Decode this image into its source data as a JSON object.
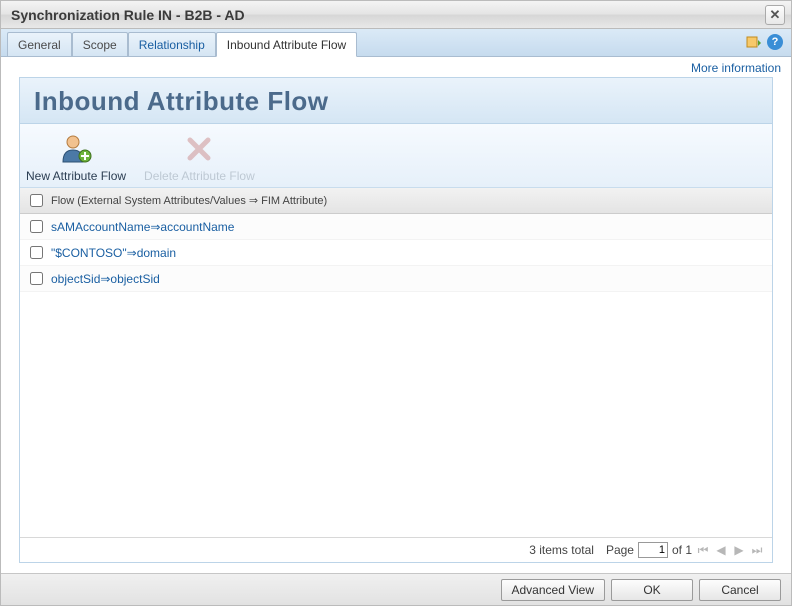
{
  "dialog": {
    "title": "Synchronization Rule IN - B2B - AD",
    "close_symbol": "✕"
  },
  "tabs": [
    {
      "label": "General",
      "link": false,
      "active": false
    },
    {
      "label": "Scope",
      "link": false,
      "active": false
    },
    {
      "label": "Relationship",
      "link": true,
      "active": false
    },
    {
      "label": "Inbound Attribute Flow",
      "link": false,
      "active": true
    }
  ],
  "more_info_label": "More information",
  "panel": {
    "title": "Inbound Attribute Flow"
  },
  "toolbar": {
    "new_flow_label": "New Attribute Flow",
    "delete_flow_label": "Delete Attribute Flow"
  },
  "grid": {
    "header_label": "Flow (External System Attributes/Values ⇒ FIM Attribute)",
    "rows": [
      {
        "text": "sAMAccountName⇒accountName"
      },
      {
        "text": "\"$CONTOSO\"⇒domain"
      },
      {
        "text": "objectSid⇒objectSid"
      }
    ]
  },
  "footer": {
    "total_text": "3 items total",
    "page_label": "Page",
    "page_current": "1",
    "page_of": "of 1"
  },
  "buttons": {
    "advanced": "Advanced View",
    "ok": "OK",
    "cancel": "Cancel"
  }
}
